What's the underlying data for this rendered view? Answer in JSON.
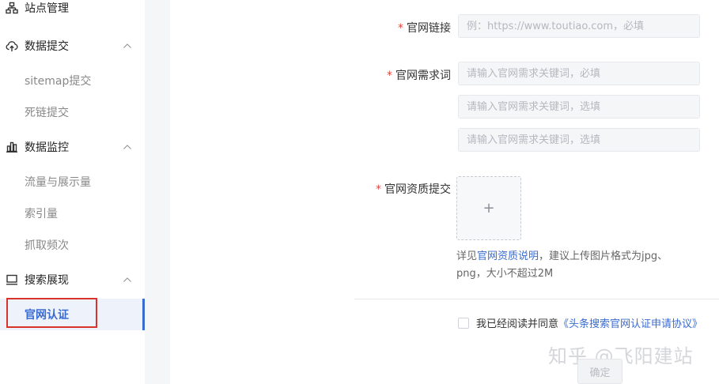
{
  "sidebar": {
    "site_management": {
      "label": "站点管理",
      "icon": "sitemap-icon"
    },
    "data_submit": {
      "label": "数据提交",
      "icon": "cloud-upload-icon",
      "items": [
        "sitemap提交",
        "死链提交"
      ]
    },
    "data_monitor": {
      "label": "数据监控",
      "icon": "bar-chart-icon",
      "items": [
        "流量与展示量",
        "索引量",
        "抓取频次"
      ]
    },
    "search_display": {
      "label": "搜索展现",
      "icon": "monitor-icon",
      "items": [
        "官网认证"
      ]
    }
  },
  "form": {
    "official_link": {
      "label": "官网链接",
      "placeholder": "例：https://www.toutiao.com，必填"
    },
    "keywords": {
      "label": "官网需求词",
      "placeholders": [
        "请输入官网需求关键词，必填",
        "请输入官网需求关键词，选填",
        "请输入官网需求关键词，选填"
      ]
    },
    "qualification": {
      "label": "官网资质提交",
      "upload_symbol": "+",
      "hint_prefix": "详见",
      "hint_link": "官网资质说明",
      "hint_suffix": "，建议上传图片格式为jpg、png，大小不超过2M"
    },
    "agreement": {
      "text": "我已经阅读并同意",
      "link": "《头条搜索官网认证申请协议》"
    },
    "confirm_label": "确定",
    "required_mark": "*"
  },
  "watermark": "知乎 @飞阳建站",
  "colors": {
    "accent": "#3a6bd0",
    "required": "#e0473e",
    "highlight_box": "#d9342b"
  }
}
